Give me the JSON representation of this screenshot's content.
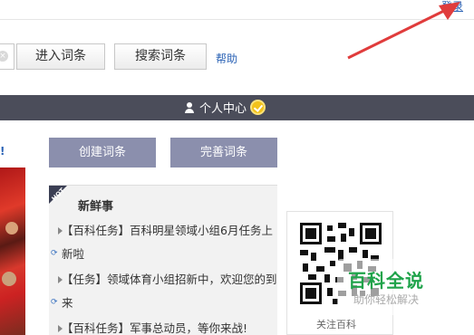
{
  "header": {
    "login_label": "登录"
  },
  "search": {
    "enter_entry_label": "进入词条",
    "search_entry_label": "搜索词条",
    "help_label": "帮助"
  },
  "nav": {
    "user_center_label": "个人中心"
  },
  "left": {
    "edge_text": "!"
  },
  "actions": {
    "create_label": "创建词条",
    "improve_label": "完善词条"
  },
  "news": {
    "badge": "HOT",
    "title": "新鲜事",
    "items": [
      {
        "line1": "【百科任务】百科明星领域小组6月任务上",
        "line2": "新啦"
      },
      {
        "line1": "【任务】领域体育小组招新中，欢迎您的到",
        "line2": "来"
      },
      {
        "line1": "【百科任务】军事总动员，等你来战!",
        "line2": ""
      }
    ]
  },
  "qr": {
    "label": "关注百科"
  },
  "watermark": {
    "title": "百科全说",
    "subtitle": "助你轻松解决"
  },
  "colors": {
    "link": "#2a62b5",
    "nav_bar": "#4b4d5a",
    "action_button": "#8b8fad",
    "arrow": "#e03c3c",
    "watermark": "#1fa34a"
  }
}
